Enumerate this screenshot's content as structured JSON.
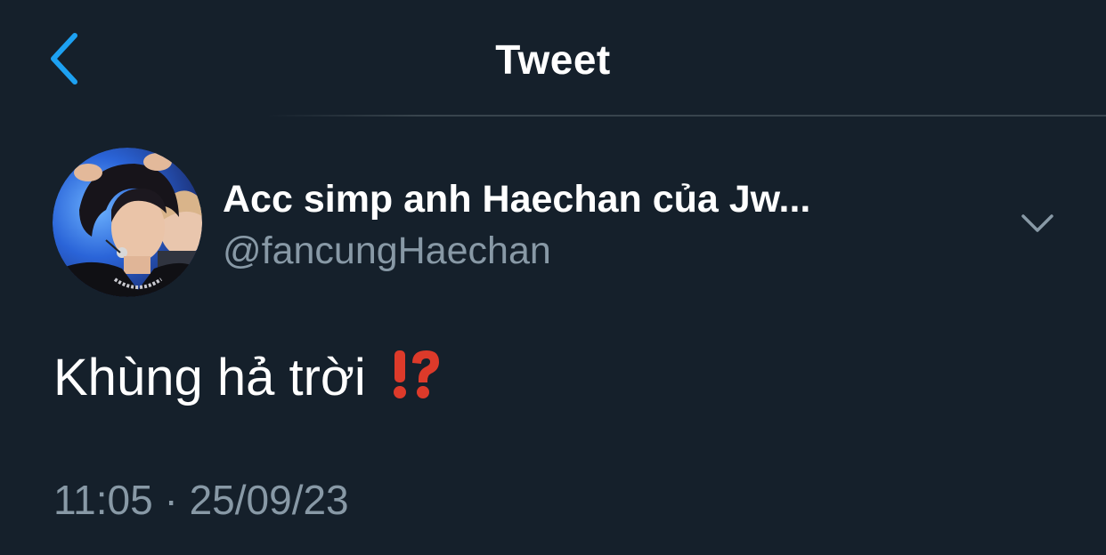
{
  "header": {
    "back_icon": "chevron-left-icon",
    "title": "Tweet",
    "accent_color": "#1da1f2"
  },
  "author": {
    "avatar_icon": "profile-photo-avatar",
    "display_name": "Acc simp anh Haechan của Jw...",
    "handle": "@fancungHaechan",
    "menu_icon": "chevron-down-icon"
  },
  "tweet": {
    "text": "Khùng hả trời",
    "emoji": "⁉️",
    "emoji_icon": "exclamation-question-mark-icon",
    "timestamp": "11:05 · 25/09/23"
  },
  "colors": {
    "background": "#15202b",
    "primary_text": "#ffffff",
    "secondary_text": "#8899a6",
    "divider": "#38444d",
    "emoji_red": "#dd3a2a"
  }
}
